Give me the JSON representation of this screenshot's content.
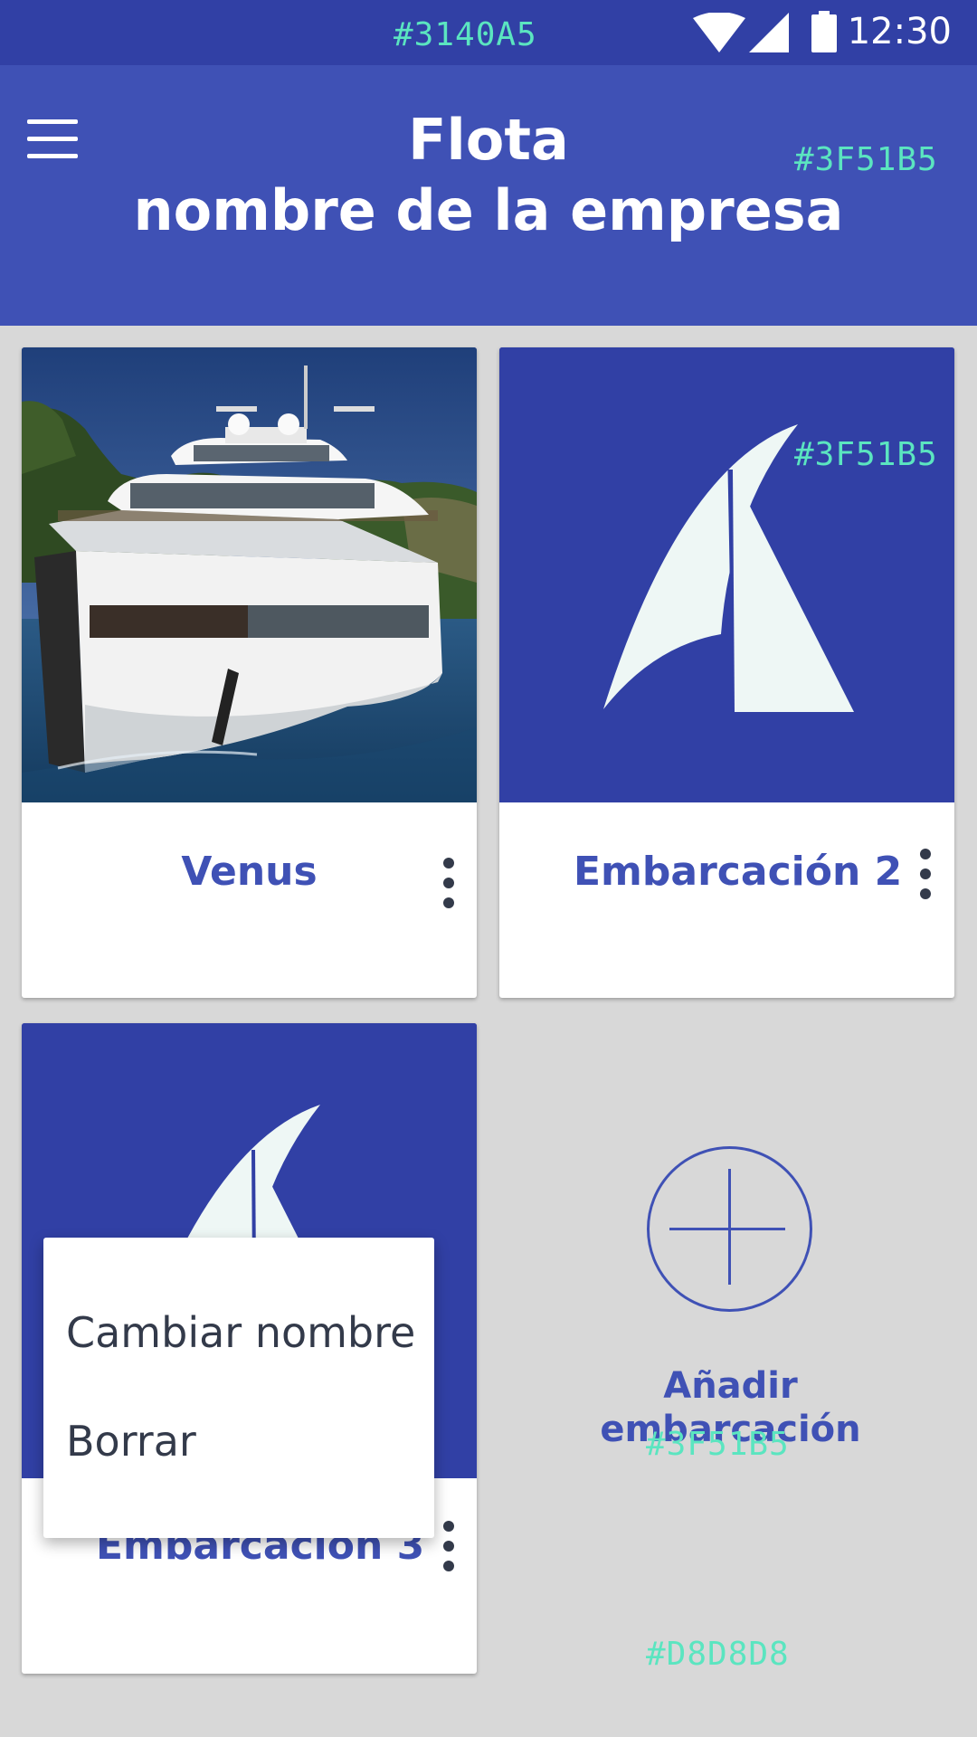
{
  "status_bar": {
    "color_annotation": "#3140A5",
    "time": "12:30"
  },
  "app_bar": {
    "title": "Flota",
    "subtitle": "nombre de la empresa",
    "color_annotation": "#3F51B5",
    "menu_icon": "hamburger-menu-icon"
  },
  "cards": [
    {
      "title": "Venus",
      "media": "yacht-photo",
      "menu_icon": "more-vert-icon"
    },
    {
      "title": "Embarcación 2",
      "media": "sail-placeholder",
      "menu_icon": "more-vert-icon",
      "color_annotation": "#3F51B5"
    },
    {
      "title": "Embarcación 3",
      "media": "sail-placeholder",
      "menu_icon": "more-vert-icon"
    }
  ],
  "context_menu": {
    "items": [
      "Cambiar nombre",
      "Borrar"
    ]
  },
  "add_tile": {
    "label_line1": "Añadir",
    "label_line2": "embarcación",
    "icon": "add-circle-icon",
    "color_annotation": "#3F51B5",
    "background_annotation": "#D8D8D8"
  },
  "colors": {
    "primary": "#3F51B5",
    "primary_dark": "#3140A5",
    "background": "#D8D8D8",
    "sail": "#EEF7F5",
    "annotation": "#5BE5C0"
  }
}
